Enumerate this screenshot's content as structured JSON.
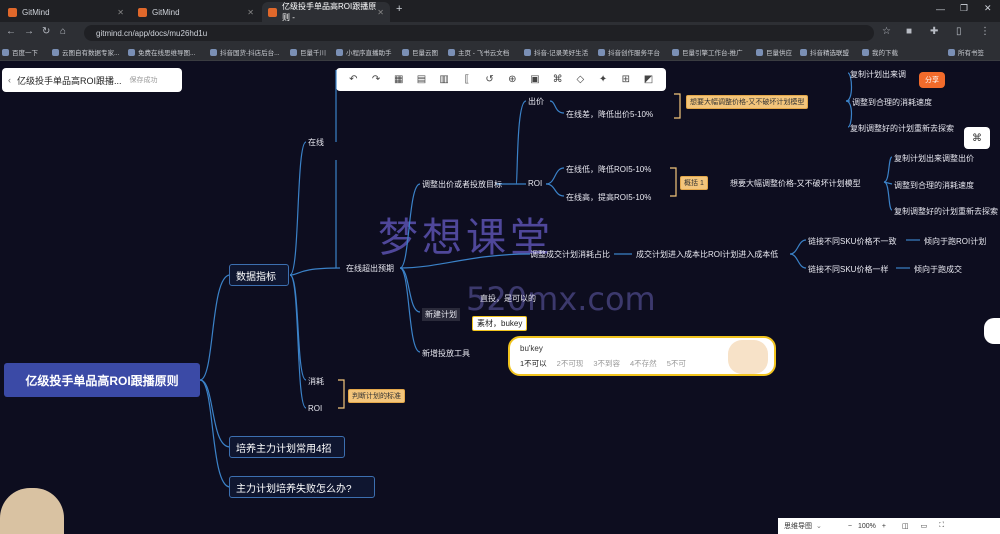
{
  "browser": {
    "tabs": [
      {
        "label": "GitMind"
      },
      {
        "label": "GitMind"
      },
      {
        "label": "亿级投手单品高ROI跟播原则 -"
      }
    ],
    "url": "gitmind.cn/app/docs/mu26hd1u",
    "bookmarks": [
      "百度一下",
      "云图自有数据专家...",
      "免费在线思维导图...",
      "抖音国货-抖店后台...",
      "巨量千川",
      "小程序直播助手",
      "巨量云图",
      "主页 - 飞书云文档",
      "抖音-记录美好生活",
      "抖音创作服务平台",
      "巨量引擎工作台-推广",
      "巨量供应",
      "抖音精选联盟",
      "我的下载",
      "所有书签"
    ]
  },
  "app": {
    "doc_title": "亿级投手单品高ROI跟播...",
    "save_status": "保存成功",
    "share_label": "分享",
    "view_mode": "思维导图",
    "zoom": "100%"
  },
  "mindmap": {
    "root": "亿级投手单品高ROI跟播原则",
    "level1": [
      "数据指标",
      "培养主力计划常用4招",
      "主力计划培养失败怎么办?"
    ],
    "level2": [
      "在线",
      "在线超出预期",
      "消耗",
      "ROI"
    ],
    "judge_tag": "判断计划的标准",
    "level3": [
      "调整出价或者投放目标",
      "新建计划",
      "新增投放工具",
      "调整成交计划消耗占比"
    ],
    "bid": "出价",
    "bid_child": "在线差，降低出价5-10%",
    "roi": "ROI",
    "roi_children": [
      "在线低，降低ROI5-10%",
      "在线高，提高ROI5-10%"
    ],
    "tag_bid": "想要大幅调整价格-又不破坏计划模型",
    "tag_roi": "概括 1",
    "roi_summary": "想要大幅调整价格-又不破坏计划模型",
    "actions": [
      "复制计划出来调整出价",
      "调整到合理的消耗速度",
      "复制调整好的计划重新去探索"
    ],
    "actions_top": [
      "复制计划出来调",
      "调整到合理的消耗速度",
      "复制调整好的计划重新去探索"
    ],
    "consume_ratio": "成交计划进入成本比ROI计划进入成本低",
    "sku_diff": "链接不同SKU价格不一致",
    "sku_diff_res": "倾向于跑ROI计划",
    "sku_same": "链接不同SKU价格一样",
    "sku_same_res": "倾向于跑成交",
    "direct": "直投，是可以的",
    "material": "素材，bukey"
  },
  "ime": {
    "input": "bu'key",
    "candidates": [
      "1不可以",
      "2不可现",
      "3不到容",
      "4不存然",
      "5不可"
    ]
  },
  "watermark": {
    "cn": "梦想课堂",
    "url": "520mx.com"
  }
}
